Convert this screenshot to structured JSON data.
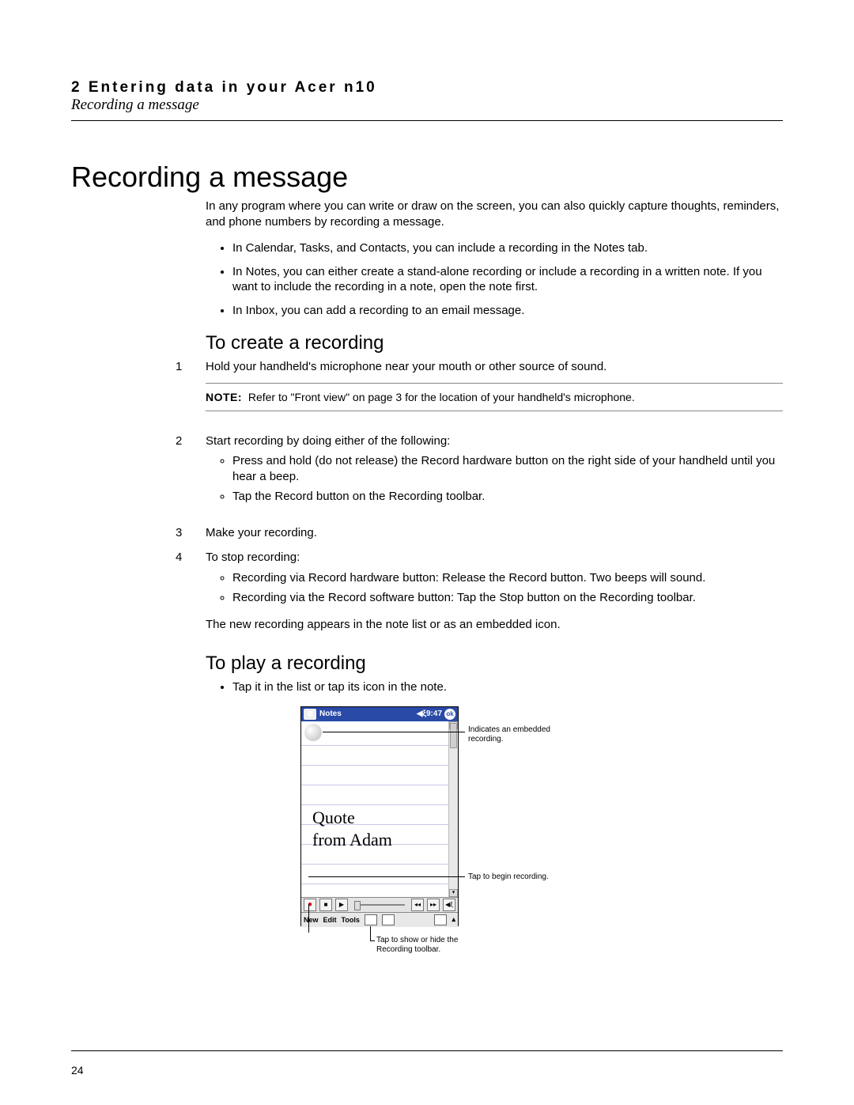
{
  "header": {
    "chapter": "2 Entering data in your Acer n10",
    "section": "Recording a message"
  },
  "title": "Recording a message",
  "intro": "In any program where you can write or draw on the screen, you can also quickly capture thoughts, reminders, and phone numbers by recording a message.",
  "intro_bullets": [
    "In Calendar, Tasks, and Contacts, you can include a recording in the Notes tab.",
    "In Notes, you can either create a stand-alone recording or include a recording in a written note. If you want to include the recording in a note, open the note first.",
    "In Inbox, you can add a recording to an email message."
  ],
  "section_create": {
    "heading": "To create a recording",
    "steps": {
      "s1": "Hold your handheld's microphone near your mouth or other source of sound.",
      "note_label": "NOTE:",
      "note_text": "Refer to \"Front view\" on page 3 for the location of your handheld's microphone.",
      "s2": "Start recording by doing either of the following:",
      "s2_bullets": [
        "Press and hold (do not release) the Record hardware button on the right side of your handheld until you hear a beep.",
        "Tap the Record button on the Recording toolbar."
      ],
      "s3": "Make your recording.",
      "s4": "To stop recording:",
      "s4_bullets": [
        "Recording via Record hardware button: Release the Record button. Two beeps will sound.",
        "Recording via the Record software button: Tap the Stop button on the Recording toolbar."
      ],
      "after": "The new recording appears in the note list or as an embedded icon."
    }
  },
  "section_play": {
    "heading": "To play a recording",
    "bullet": "Tap it in the list or tap its icon in the note."
  },
  "pda": {
    "app_title": "Notes",
    "time": "9:47",
    "ok": "ok",
    "handwriting_l1": "Quote",
    "handwriting_l2": "from Adam",
    "menu_new": "New",
    "menu_edit": "Edit",
    "menu_tools": "Tools"
  },
  "callouts": {
    "embedded": "Indicates an embedded recording.",
    "begin": "Tap to begin recording.",
    "toggle": "Tap to show or hide the Recording toolbar."
  },
  "page_number": "24"
}
